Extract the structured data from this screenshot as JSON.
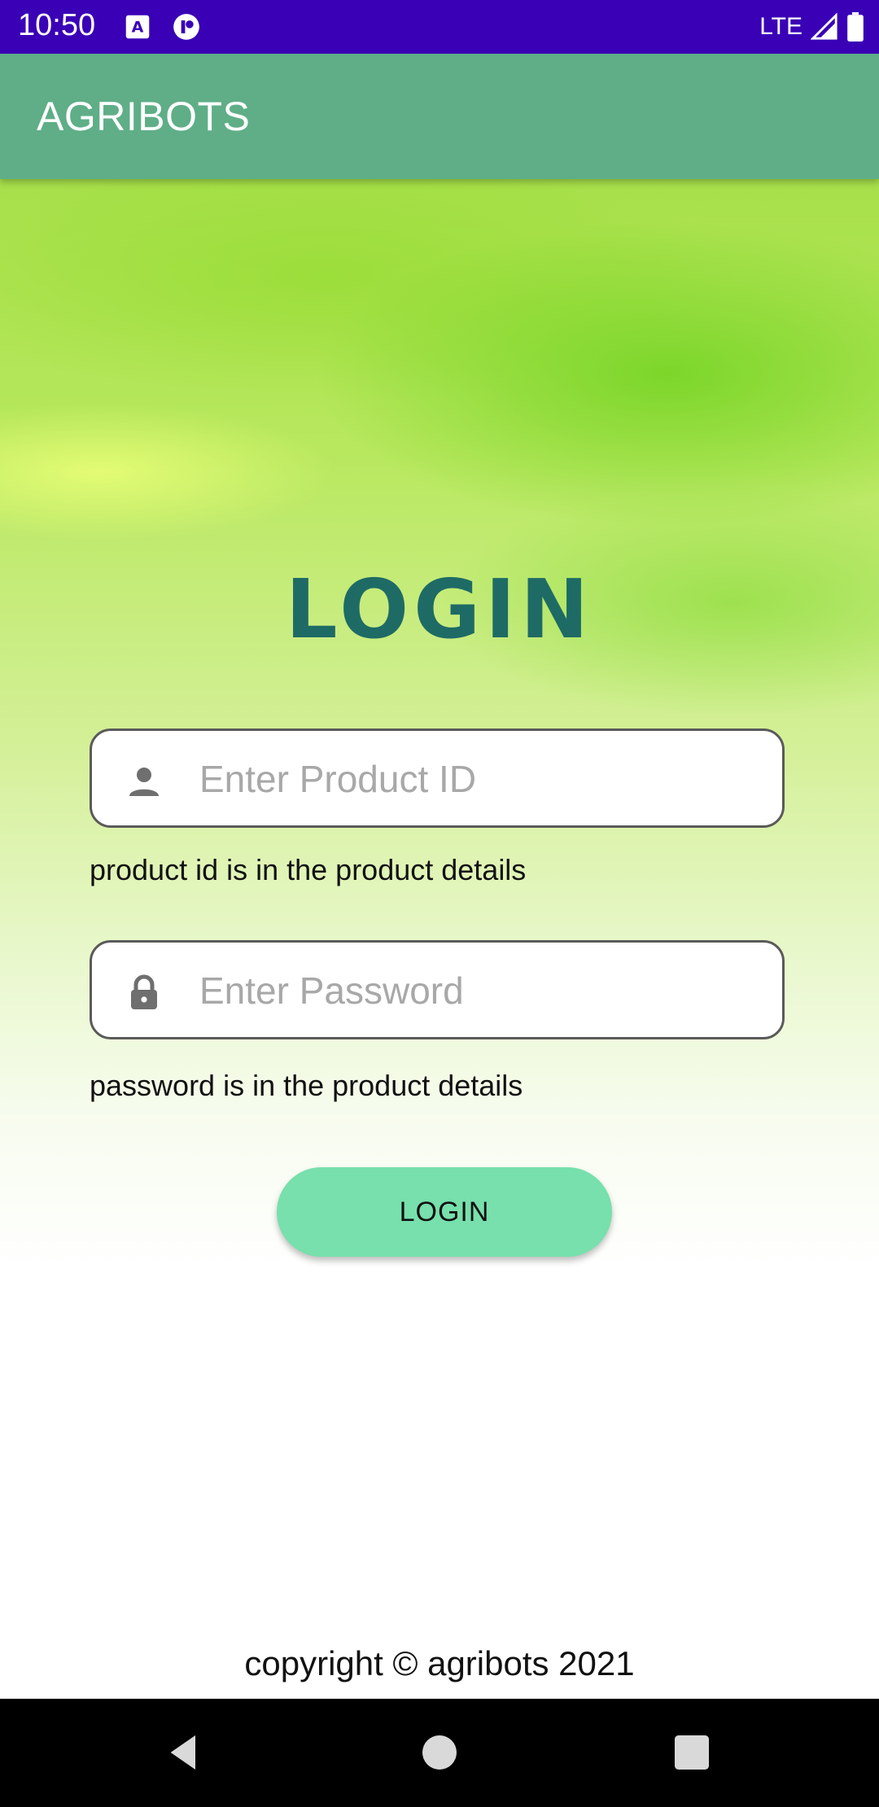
{
  "status_bar": {
    "time": "10:50",
    "network": "LTE",
    "icons": [
      "font-a-icon",
      "app-notification-icon",
      "signal-icon",
      "battery-icon"
    ]
  },
  "app_bar": {
    "title": "AGRIBOTS"
  },
  "login": {
    "heading": "LOGIN",
    "product_id": {
      "placeholder": "Enter Product ID",
      "value": "",
      "helper": "product id is in the product details",
      "icon": "person-icon"
    },
    "password": {
      "placeholder": "Enter Password",
      "value": "",
      "helper": "password is in the product details",
      "icon": "lock-icon"
    },
    "button_label": "LOGIN"
  },
  "footer": {
    "copyright": "copyright © agribots 2021"
  },
  "nav_bar": {
    "buttons": [
      "back-icon",
      "home-icon",
      "recents-icon"
    ]
  },
  "colors": {
    "status_bar": "#3a00b6",
    "app_bar": "#5fae87",
    "heading": "#1e6b66",
    "button": "#77e0ac"
  }
}
